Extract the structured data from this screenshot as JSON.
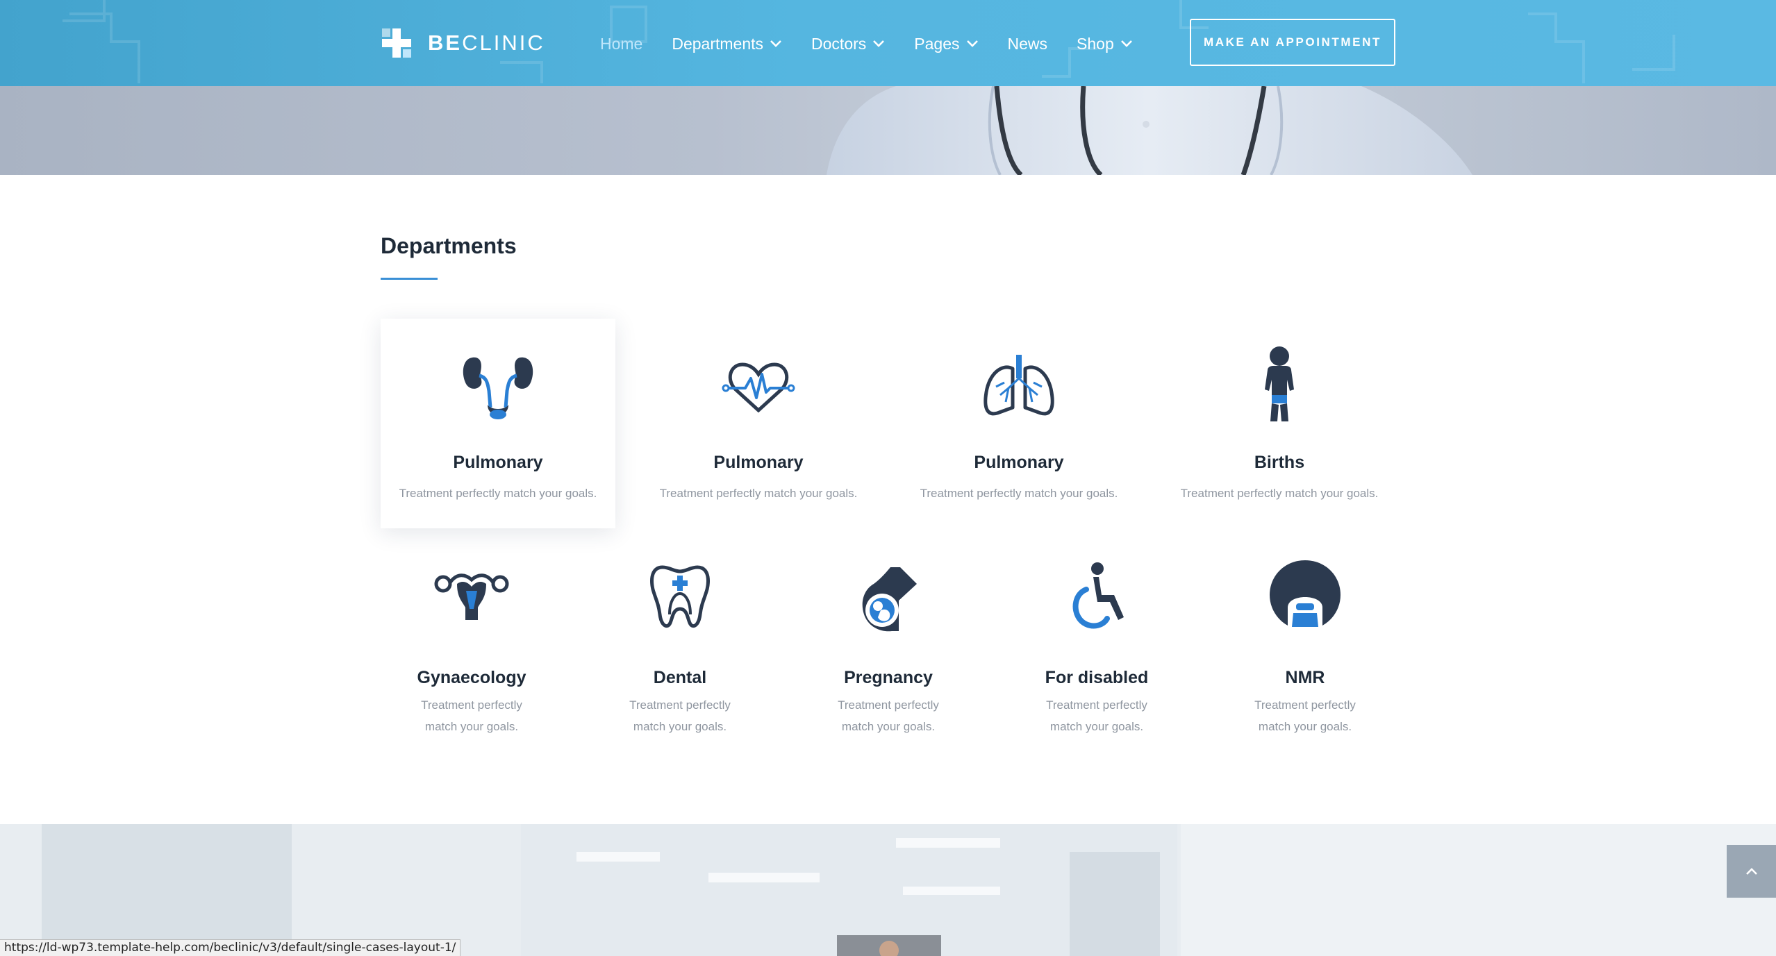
{
  "header": {
    "logo": {
      "text_bold": "BE",
      "text_light": "CLINIC"
    },
    "nav": [
      {
        "label": "Home",
        "active": true,
        "dropdown": false
      },
      {
        "label": "Departments",
        "active": false,
        "dropdown": true
      },
      {
        "label": "Doctors",
        "active": false,
        "dropdown": true
      },
      {
        "label": "Pages",
        "active": false,
        "dropdown": true
      },
      {
        "label": "News",
        "active": false,
        "dropdown": false
      },
      {
        "label": "Shop",
        "active": false,
        "dropdown": true
      }
    ],
    "cta_label": "MAKE AN APPOINTMENT"
  },
  "departments": {
    "title": "Departments",
    "row1": [
      {
        "name": "Pulmonary",
        "desc": "Treatment perfectly match your goals.",
        "icon": "kidneys-icon",
        "highlighted": true
      },
      {
        "name": "Pulmonary",
        "desc": "Treatment perfectly match your goals.",
        "icon": "heart-pulse-icon",
        "highlighted": false
      },
      {
        "name": "Pulmonary",
        "desc": "Treatment perfectly match your goals.",
        "icon": "lungs-icon",
        "highlighted": false
      },
      {
        "name": "Births",
        "desc": "Treatment perfectly match your goals.",
        "icon": "baby-icon",
        "highlighted": false
      }
    ],
    "row2": [
      {
        "name": "Gynaecology",
        "desc": "Treatment perfectly match your goals.",
        "icon": "uterus-icon"
      },
      {
        "name": "Dental",
        "desc": "Treatment perfectly match your goals.",
        "icon": "tooth-icon"
      },
      {
        "name": "Pregnancy",
        "desc": "Treatment perfectly match your goals.",
        "icon": "pregnancy-icon"
      },
      {
        "name": "For disabled",
        "desc": "Treatment perfectly match your goals.",
        "icon": "wheelchair-icon"
      },
      {
        "name": "NMR",
        "desc": "Treatment perfectly match your goals.",
        "icon": "mri-scanner-icon"
      }
    ]
  },
  "status_bar": {
    "url": "https://ld-wp73.template-help.com/beclinic/v3/default/single-cases-layout-1/"
  },
  "colors": {
    "header": "#55b6e0",
    "accent": "#3a8fd6",
    "icon_dark": "#2c3a4f",
    "icon_blue": "#2a7fd4"
  }
}
